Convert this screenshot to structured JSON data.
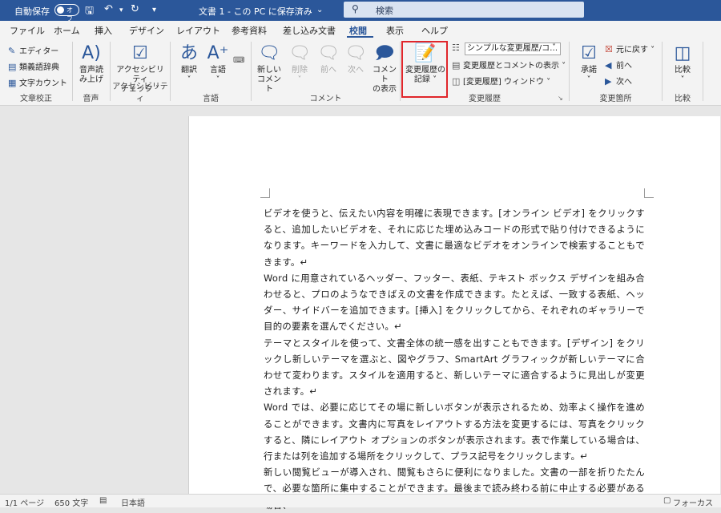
{
  "titlebar": {
    "autosave": "自動保存",
    "toggle_state": "オフ",
    "doc_title": "文書 1 - この PC に保存済み",
    "search_placeholder": "検索"
  },
  "tabs": [
    "ファイル",
    "ホーム",
    "挿入",
    "デザイン",
    "レイアウト",
    "参考資料",
    "差し込み文書",
    "校閲",
    "表示",
    "ヘルプ"
  ],
  "active_tab": "校閲",
  "ribbon": {
    "proofing": {
      "label": "文章校正",
      "editor": "エディター",
      "thesaurus": "類義語辞典",
      "word_count": "文字カウント"
    },
    "speech": {
      "label": "音声",
      "read_aloud_1": "音声読",
      "read_aloud_2": "み上げ"
    },
    "accessibility": {
      "label": "アクセシビリティ",
      "check_1": "アクセシビリティ",
      "check_2": "チェック"
    },
    "language": {
      "label": "言語",
      "translate": "翻訳",
      "language": "言語"
    },
    "comments": {
      "label": "コメント",
      "new_1": "新しい",
      "new_2": "コメント",
      "delete": "削除",
      "prev": "前へ",
      "next": "次へ",
      "show_1": "コメント",
      "show_2": "の表示"
    },
    "tracking": {
      "label": "変更履歴",
      "track_1": "変更履歴の",
      "track_2": "記録",
      "markup_select": "シンプルな変更履歴/コ…",
      "show_markup": "変更履歴とコメントの表示",
      "pane": "[変更履歴] ウィンドウ"
    },
    "changes": {
      "label": "変更箇所",
      "accept": "承諾",
      "reject": "元に戻す",
      "prev": "前へ",
      "next": "次へ"
    },
    "compare": {
      "label": "比較",
      "compare": "比較"
    }
  },
  "document": {
    "paragraphs": [
      "ビデオを使うと、伝えたい内容を明確に表現できます。[オンライン ビデオ] をクリックすると、追加したいビデオを、それに応じた埋め込みコードの形式で貼り付けできるようになります。キーワードを入力して、文書に最適なビデオをオンラインで検索することもできます。↵",
      "Word に用意されているヘッダー、フッター、表紙、テキスト ボックス デザインを組み合わせると、プロのようなできばえの文書を作成できます。たとえば、一致する表紙、ヘッダー、サイドバーを追加できます。[挿入] をクリックしてから、それぞれのギャラリーで目的の要素を選んでください。↵",
      "テーマとスタイルを使って、文書全体の統一感を出すこともできます。[デザイン] をクリックし新しいテーマを選ぶと、図やグラフ、SmartArt グラフィックが新しいテーマに合わせて変わります。スタイルを適用すると、新しいテーマに適合するように見出しが変更されます。↵",
      "Word では、必要に応じてその場に新しいボタンが表示されるため、効率よく操作を進めることができます。文書内に写真をレイアウトする方法を変更するには、写真をクリックすると、隣にレイアウト オプションのボタンが表示されます。表で作業している場合は、行または列を追加する場所をクリックして、プラス記号をクリックします。↵",
      "新しい閲覧ビューが導入され、閲覧もさらに便利になりました。文書の一部を折りたたんで、必要な箇所に集中することができます。最後まで読み終わる前に中止する必要がある場合、"
    ]
  },
  "status": {
    "page": "1/1 ページ",
    "words": "650 文字",
    "lang": "日本語",
    "focus": "フォーカス"
  }
}
